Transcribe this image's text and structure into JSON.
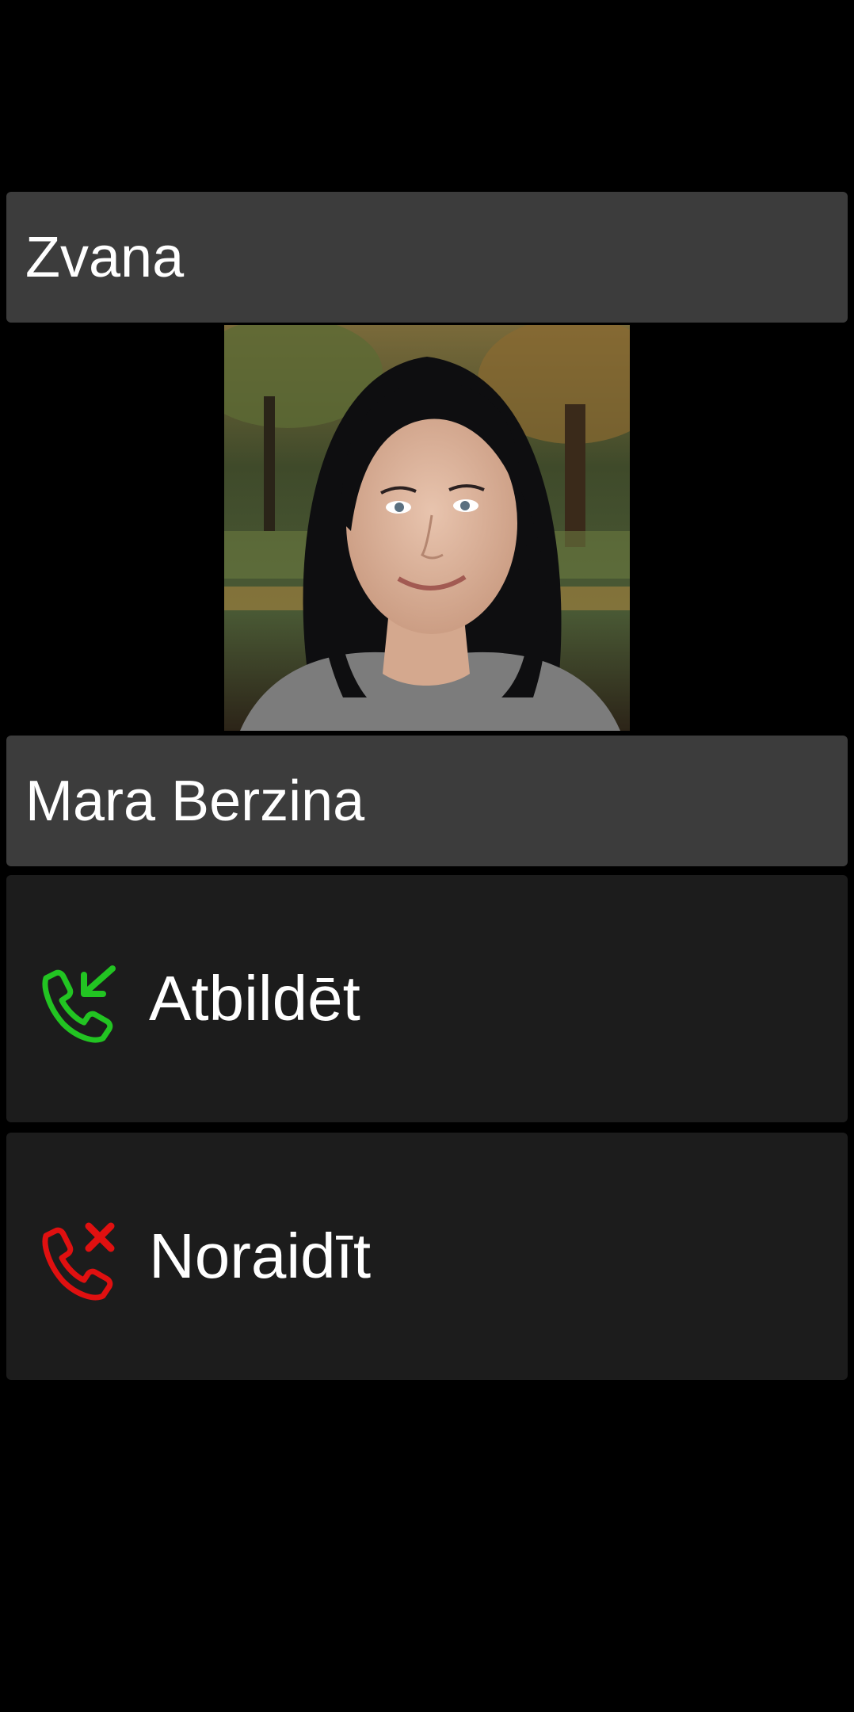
{
  "header": {
    "title": "Zvana"
  },
  "caller": {
    "name": "Mara Berzina"
  },
  "actions": {
    "answer": {
      "label": "Atbildēt",
      "icon": "incoming-call-icon",
      "color": "#22c422"
    },
    "decline": {
      "label": "Noraidīt",
      "icon": "missed-call-icon",
      "color": "#e01010"
    }
  },
  "colors": {
    "background": "#000000",
    "bar": "#3c3c3c",
    "action_bg": "#1c1c1c"
  }
}
